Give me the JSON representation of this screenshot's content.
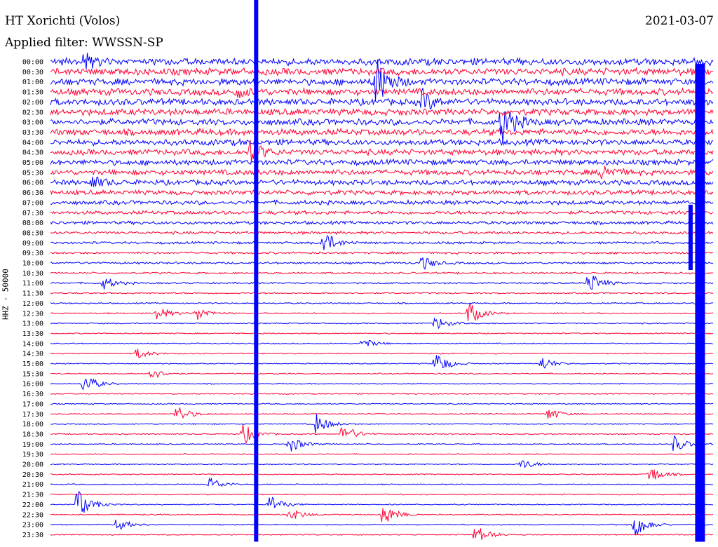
{
  "header": {
    "station": "HT Xorichti (Volos)",
    "date": "2021-03-07",
    "filter": "Applied filter: WWSSN-SP"
  },
  "channel_label": "HHZ - 50000",
  "chart_data": {
    "type": "line",
    "title": "HT Xorichti (Volos)",
    "subtitle": "Applied filter: WWSSN-SP",
    "ylabel": "HHZ - 50000",
    "categories": [
      "00:00",
      "00:30",
      "01:00",
      "01:30",
      "02:00",
      "02:30",
      "03:00",
      "03:30",
      "04:00",
      "04:30",
      "05:00",
      "05:30",
      "06:00",
      "06:30",
      "07:00",
      "07:30",
      "08:00",
      "08:30",
      "09:00",
      "09:30",
      "10:00",
      "10:30",
      "11:00",
      "11:30",
      "12:00",
      "12:30",
      "13:00",
      "13:30",
      "14:00",
      "14:30",
      "15:00",
      "15:30",
      "16:00",
      "16:30",
      "17:00",
      "17:30",
      "18:00",
      "18:30",
      "19:00",
      "19:30",
      "20:00",
      "20:30",
      "21:00",
      "21:30",
      "22:00",
      "22:30",
      "23:00",
      "23:30"
    ],
    "series_colors": [
      "#0000ff",
      "#ff0033"
    ],
    "noise_level": [
      0.75,
      0.75,
      0.72,
      0.72,
      0.7,
      0.7,
      0.68,
      0.68,
      0.65,
      0.62,
      0.6,
      0.58,
      0.55,
      0.5,
      0.45,
      0.4,
      0.35,
      0.3,
      0.26,
      0.24,
      0.22,
      0.2,
      0.18,
      0.16,
      0.15,
      0.14,
      0.13,
      0.13,
      0.12,
      0.12,
      0.12,
      0.12,
      0.12,
      0.12,
      0.12,
      0.12,
      0.12,
      0.12,
      0.12,
      0.12,
      0.12,
      0.12,
      0.12,
      0.12,
      0.12,
      0.12,
      0.12,
      0.12
    ],
    "events": [
      {
        "row": 0,
        "x": 0.05,
        "amp": 2.0
      },
      {
        "row": 2,
        "x": 0.49,
        "amp": 7.0
      },
      {
        "row": 3,
        "x": 0.28,
        "amp": 1.5
      },
      {
        "row": 4,
        "x": 0.56,
        "amp": 3.0
      },
      {
        "row": 6,
        "x": 0.68,
        "amp": 6.0
      },
      {
        "row": 9,
        "x": 0.3,
        "amp": 4.0
      },
      {
        "row": 11,
        "x": 0.83,
        "amp": 2.5
      },
      {
        "row": 12,
        "x": 0.06,
        "amp": 2.0
      },
      {
        "row": 18,
        "x": 0.41,
        "amp": 3.5
      },
      {
        "row": 20,
        "x": 0.56,
        "amp": 2.0
      },
      {
        "row": 22,
        "x": 0.08,
        "amp": 1.8
      },
      {
        "row": 22,
        "x": 0.81,
        "amp": 3.5
      },
      {
        "row": 25,
        "x": 0.16,
        "amp": 2.0
      },
      {
        "row": 25,
        "x": 0.22,
        "amp": 2.0
      },
      {
        "row": 25,
        "x": 0.63,
        "amp": 3.5
      },
      {
        "row": 26,
        "x": 0.58,
        "amp": 2.0
      },
      {
        "row": 28,
        "x": 0.47,
        "amp": 1.5
      },
      {
        "row": 29,
        "x": 0.13,
        "amp": 1.5
      },
      {
        "row": 30,
        "x": 0.58,
        "amp": 3.5
      },
      {
        "row": 30,
        "x": 0.74,
        "amp": 2.0
      },
      {
        "row": 31,
        "x": 0.15,
        "amp": 1.8
      },
      {
        "row": 32,
        "x": 0.05,
        "amp": 3.0
      },
      {
        "row": 35,
        "x": 0.19,
        "amp": 2.5
      },
      {
        "row": 35,
        "x": 0.75,
        "amp": 1.8
      },
      {
        "row": 36,
        "x": 0.4,
        "amp": 3.0
      },
      {
        "row": 37,
        "x": 0.29,
        "amp": 3.0
      },
      {
        "row": 37,
        "x": 0.44,
        "amp": 3.0
      },
      {
        "row": 38,
        "x": 0.36,
        "amp": 2.5
      },
      {
        "row": 38,
        "x": 0.94,
        "amp": 2.5
      },
      {
        "row": 40,
        "x": 0.71,
        "amp": 1.5
      },
      {
        "row": 41,
        "x": 0.9,
        "amp": 3.0
      },
      {
        "row": 42,
        "x": 0.24,
        "amp": 2.0
      },
      {
        "row": 44,
        "x": 0.04,
        "amp": 5.0
      },
      {
        "row": 44,
        "x": 0.33,
        "amp": 2.5
      },
      {
        "row": 45,
        "x": 0.5,
        "amp": 3.5
      },
      {
        "row": 45,
        "x": 0.36,
        "amp": 2.0
      },
      {
        "row": 46,
        "x": 0.1,
        "amp": 2.0
      },
      {
        "row": 46,
        "x": 0.88,
        "amp": 3.5
      },
      {
        "row": 47,
        "x": 0.64,
        "amp": 3.0
      }
    ],
    "spikes": [
      {
        "x": 0.31,
        "row_from": 0,
        "row_to": 47
      },
      {
        "x": 0.975,
        "row_from": 3,
        "row_to": 47
      },
      {
        "x": 0.965,
        "row_from": 17,
        "row_to": 20
      }
    ]
  }
}
